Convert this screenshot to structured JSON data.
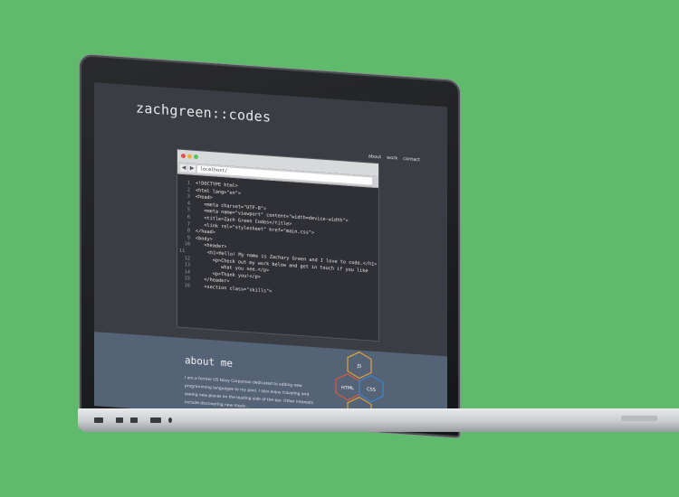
{
  "site": {
    "brand": "zachgreen::codes",
    "nav": [
      "about",
      "work",
      "contact"
    ]
  },
  "browser": {
    "url": "localhost/"
  },
  "code": [
    {
      "n": "1",
      "t": "<!DOCTYPE html>"
    },
    {
      "n": "2",
      "t": "<html lang=\"en\">"
    },
    {
      "n": "3",
      "t": "<head>"
    },
    {
      "n": "4",
      "t": "   <meta charset=\"UTF-8\">"
    },
    {
      "n": "5",
      "t": "   <meta name=\"viewport\" content=\"width=device-width\">"
    },
    {
      "n": "6",
      "t": "   <title>Zach Green Codes</title>"
    },
    {
      "n": "7",
      "t": "   <link rel=\"stylesheet\" href=\"main.css\">"
    },
    {
      "n": "8",
      "t": "</head>"
    },
    {
      "n": "9",
      "t": "<body>"
    },
    {
      "n": "10",
      "t": "   <header>"
    },
    {
      "n": "11",
      "t": "      <h1>Hello! My name is Zachary Green and I love to code.</h1>"
    },
    {
      "n": "12",
      "t": "      <p>Check out my work below and get in touch if you like"
    },
    {
      "n": "13",
      "t": "         what you see.</p>"
    },
    {
      "n": "14",
      "t": "      <p>Thank you!</p>"
    },
    {
      "n": "15",
      "t": "   </header>"
    },
    {
      "n": "16",
      "t": "   <section class=\"skills\">"
    }
  ],
  "about": {
    "heading": "about me",
    "paragraph": "I am a former US Navy Corpsman dedicated to adding new programming languages to my pool. I also enjoy traveling and seeing new places on the leading side of the bar. Other interests include discovering new music."
  },
  "hexes": [
    "JS",
    "HTML",
    "CSS"
  ],
  "colors": {
    "background": "#5fba6b",
    "screen": "#3b3d44",
    "lower_section": "#556377"
  }
}
